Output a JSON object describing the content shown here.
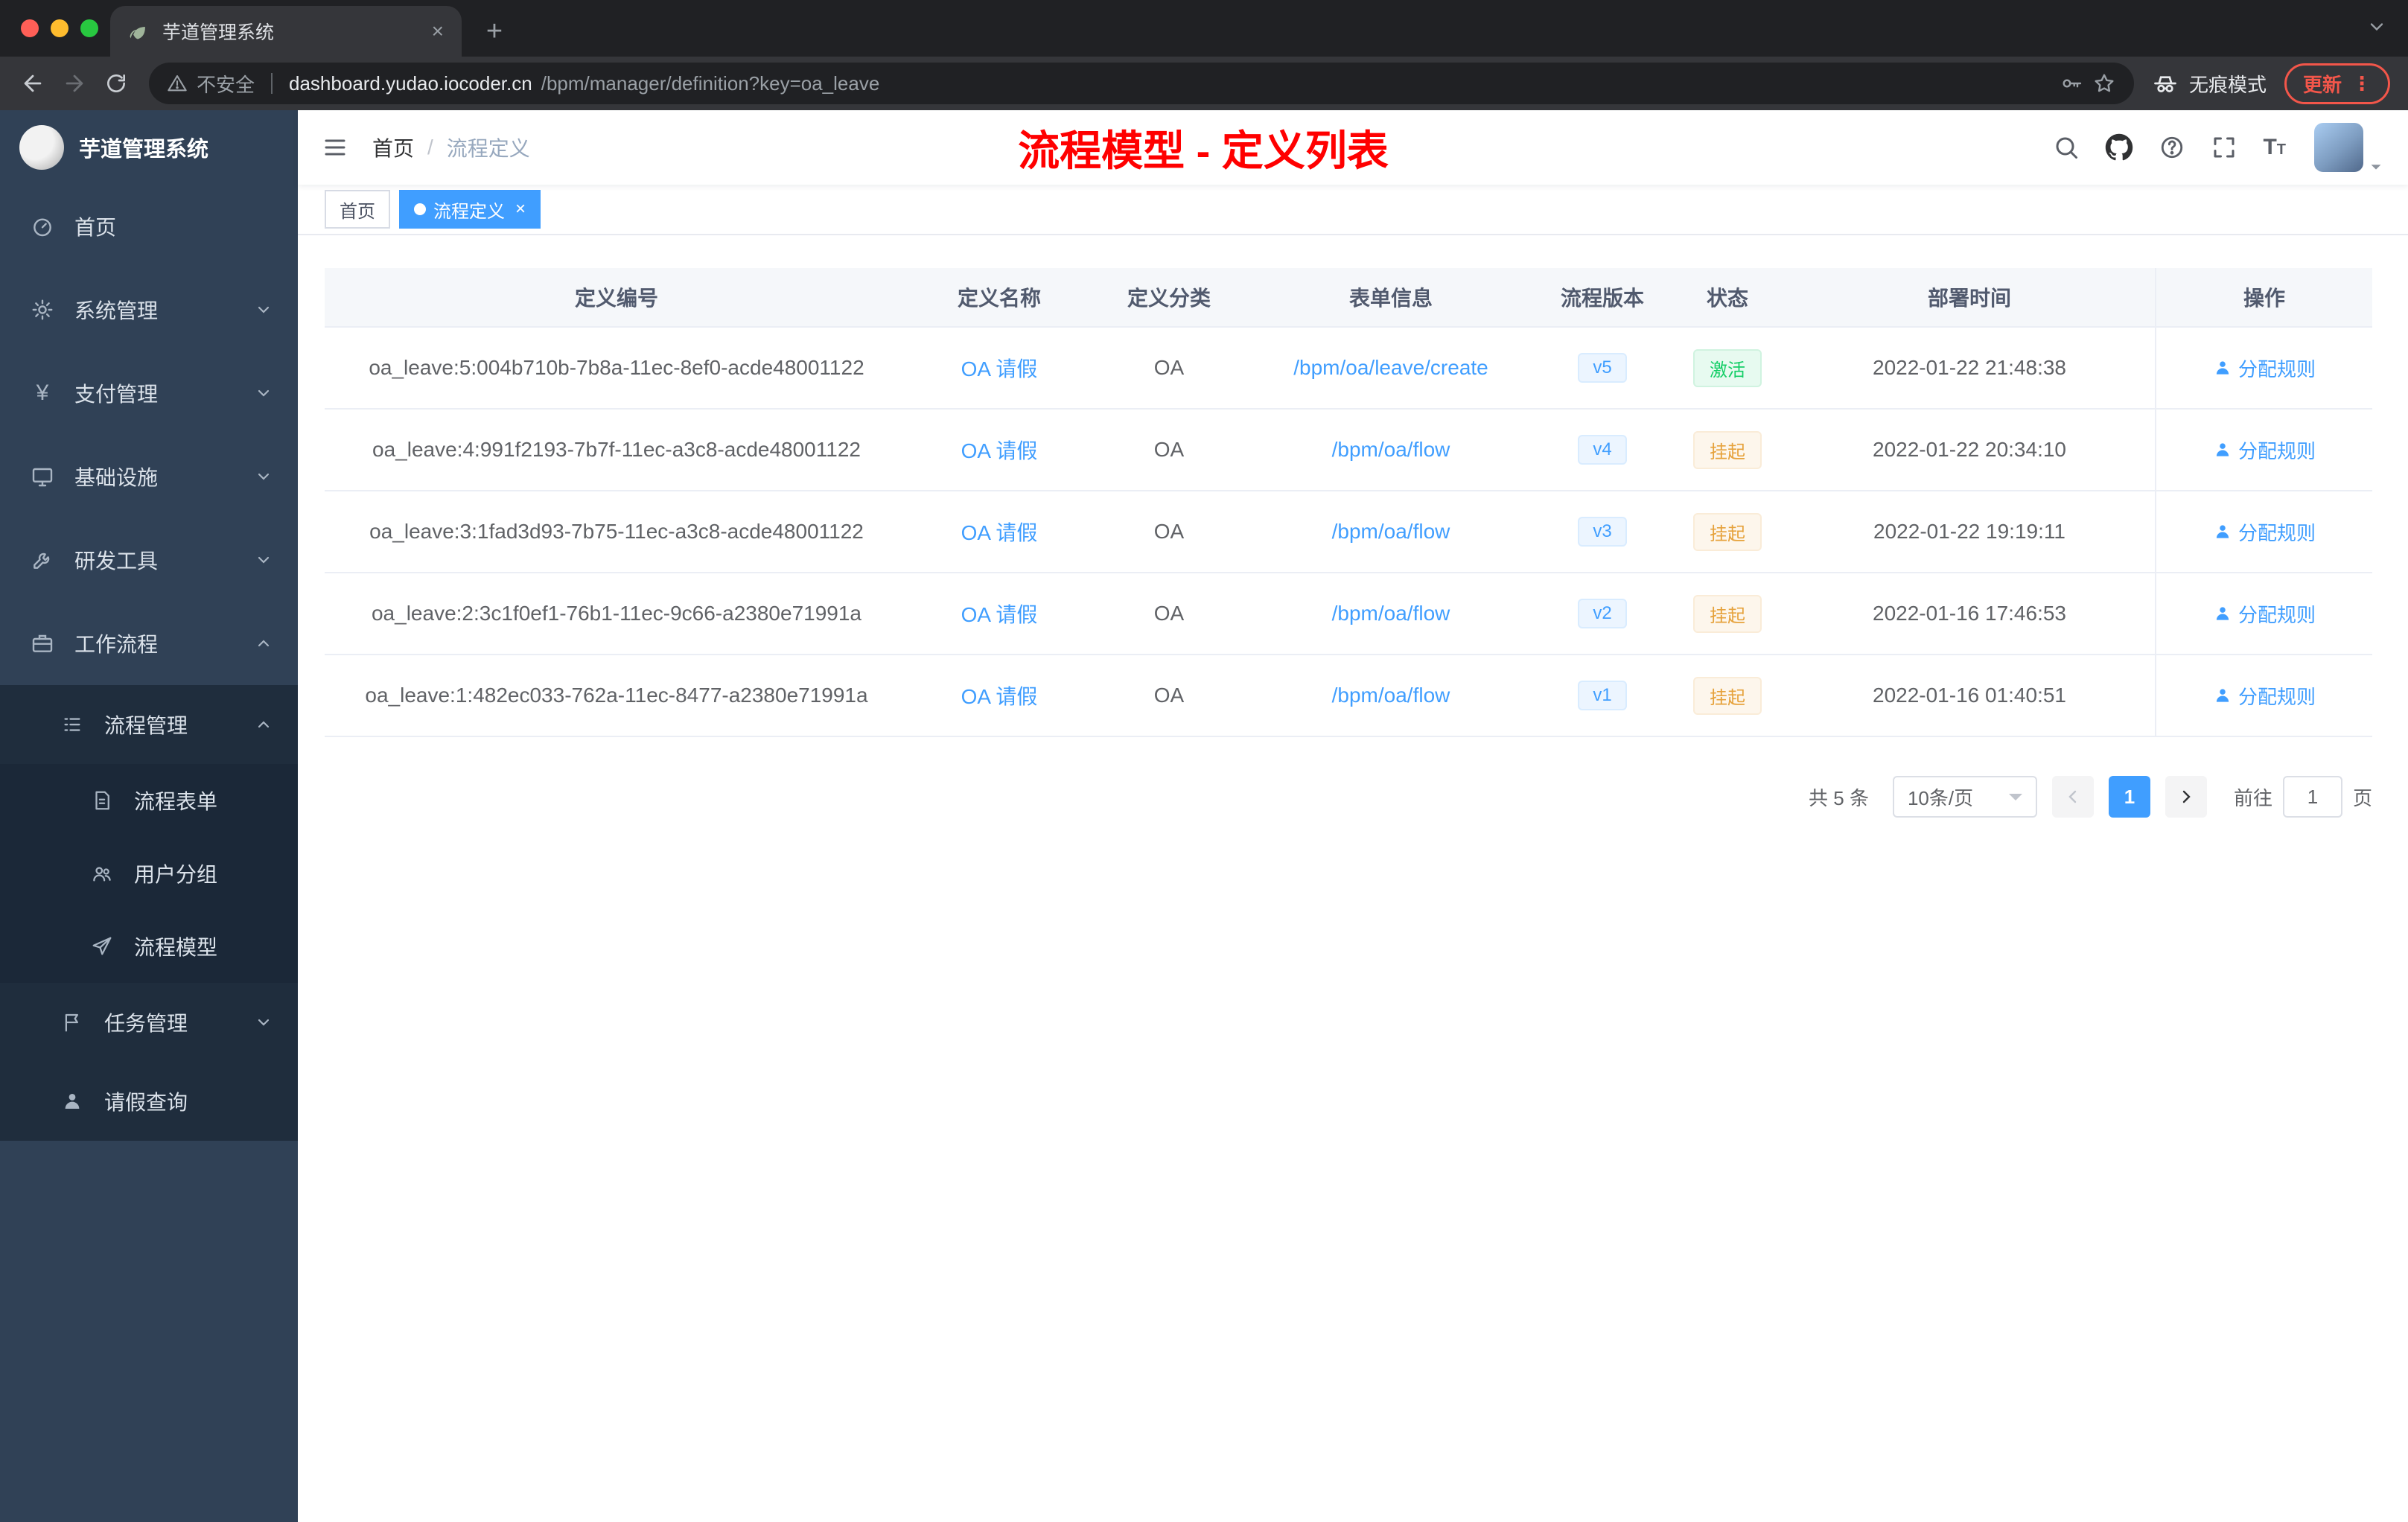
{
  "browser": {
    "tab_title": "芋道管理系统",
    "security_label": "不安全",
    "url_host": "dashboard.yudao.iocoder.cn",
    "url_path": "/bpm/manager/definition?key=oa_leave",
    "incognito_label": "无痕模式",
    "update_label": "更新"
  },
  "sidebar": {
    "title": "芋道管理系统",
    "items": [
      {
        "label": "首页"
      },
      {
        "label": "系统管理"
      },
      {
        "label": "支付管理"
      },
      {
        "label": "基础设施"
      },
      {
        "label": "研发工具"
      },
      {
        "label": "工作流程"
      }
    ],
    "submenu": {
      "process": "流程管理",
      "process_children": [
        {
          "label": "流程表单"
        },
        {
          "label": "用户分组"
        },
        {
          "label": "流程模型"
        }
      ],
      "task": "任务管理",
      "leave": "请假查询"
    }
  },
  "header": {
    "breadcrumb_home": "首页",
    "breadcrumb_sep": "/",
    "breadcrumb_current": "流程定义",
    "banner": "流程模型 - 定义列表"
  },
  "tags": [
    {
      "label": "首页"
    },
    {
      "label": "流程定义"
    }
  ],
  "table": {
    "headers": [
      "定义编号",
      "定义名称",
      "定义分类",
      "表单信息",
      "流程版本",
      "状态",
      "部署时间",
      "操作"
    ],
    "rows": [
      {
        "id": "oa_leave:5:004b710b-7b8a-11ec-8ef0-acde48001122",
        "name": "OA 请假",
        "category": "OA",
        "form": "/bpm/oa/leave/create",
        "version": "v5",
        "status": "激活",
        "status_type": "success",
        "time": "2022-01-22 21:48:38",
        "action": "分配规则"
      },
      {
        "id": "oa_leave:4:991f2193-7b7f-11ec-a3c8-acde48001122",
        "name": "OA 请假",
        "category": "OA",
        "form": "/bpm/oa/flow",
        "version": "v4",
        "status": "挂起",
        "status_type": "warning",
        "time": "2022-01-22 20:34:10",
        "action": "分配规则"
      },
      {
        "id": "oa_leave:3:1fad3d93-7b75-11ec-a3c8-acde48001122",
        "name": "OA 请假",
        "category": "OA",
        "form": "/bpm/oa/flow",
        "version": "v3",
        "status": "挂起",
        "status_type": "warning",
        "time": "2022-01-22 19:19:11",
        "action": "分配规则"
      },
      {
        "id": "oa_leave:2:3c1f0ef1-76b1-11ec-9c66-a2380e71991a",
        "name": "OA 请假",
        "category": "OA",
        "form": "/bpm/oa/flow",
        "version": "v2",
        "status": "挂起",
        "status_type": "warning",
        "time": "2022-01-16 17:46:53",
        "action": "分配规则"
      },
      {
        "id": "oa_leave:1:482ec033-762a-11ec-8477-a2380e71991a",
        "name": "OA 请假",
        "category": "OA",
        "form": "/bpm/oa/flow",
        "version": "v1",
        "status": "挂起",
        "status_type": "warning",
        "time": "2022-01-16 01:40:51",
        "action": "分配规则"
      }
    ]
  },
  "pagination": {
    "total": "共 5 条",
    "page_size": "10条/页",
    "current": "1",
    "goto_label": "前往",
    "goto_value": "1",
    "goto_unit": "页"
  },
  "colors": {
    "accent": "#409eff",
    "success": "#13ce66",
    "warning": "#e6a23c",
    "banner_red": "#ff0000",
    "sidebar_bg": "#304156",
    "submenu_bg": "#1f2d3d"
  },
  "icons": {
    "navbar": [
      "search-icon",
      "github-icon",
      "help-icon",
      "fullscreen-icon",
      "font-size-icon"
    ],
    "toolbar": [
      "back-icon",
      "forward-icon",
      "reload-icon",
      "warning-icon",
      "key-icon",
      "star-icon",
      "incognito-icon"
    ]
  }
}
